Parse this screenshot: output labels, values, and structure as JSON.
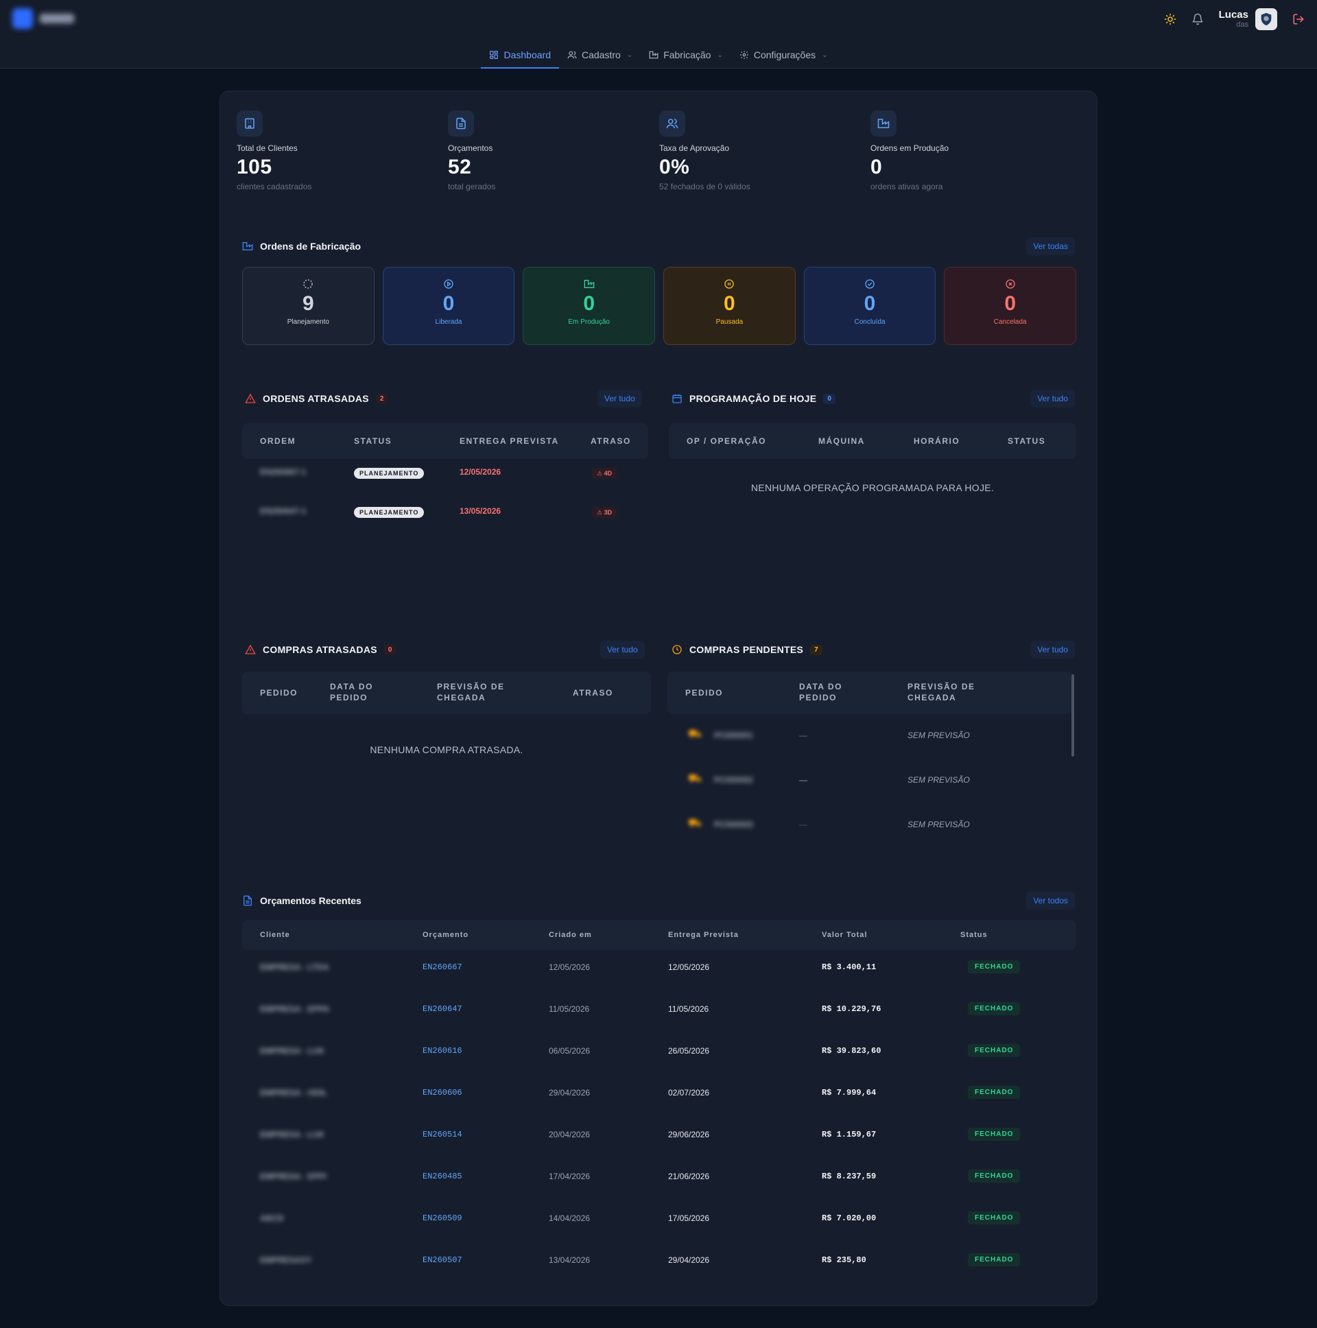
{
  "user": {
    "name": "Lucas",
    "role": "das"
  },
  "nav": [
    {
      "label": "Dashboard",
      "icon": "dashboard-icon",
      "active": true
    },
    {
      "label": "Cadastro",
      "icon": "users-icon",
      "dropdown": true
    },
    {
      "label": "Fabricação",
      "icon": "factory-icon",
      "dropdown": true
    },
    {
      "label": "Configurações",
      "icon": "gear-icon",
      "dropdown": true
    }
  ],
  "kpis": [
    {
      "label": "Total de Clientes",
      "value": "105",
      "sub": "clientes cadastrados",
      "icon": "building-icon"
    },
    {
      "label": "Orçamentos",
      "value": "52",
      "sub": "total gerados",
      "icon": "document-icon"
    },
    {
      "label": "Taxa de Aprovação",
      "value": "0%",
      "sub": "52 fechados de 0 válidos",
      "icon": "users-icon"
    },
    {
      "label": "Ordens em Produção",
      "value": "0",
      "sub": "ordens ativas agora",
      "icon": "factory-icon"
    }
  ],
  "fabrication": {
    "title": "Ordens de Fabricação",
    "link": "Ver todas",
    "cards": [
      {
        "value": "9",
        "label": "Planejamento",
        "color": "#d1d5db",
        "bg": "#1b2231",
        "border": "#374151"
      },
      {
        "value": "0",
        "label": "Liberada",
        "color": "#60a5fa",
        "bg": "#172447",
        "border": "#27427a"
      },
      {
        "value": "0",
        "label": "Em Produção",
        "color": "#34d399",
        "bg": "#13302b",
        "border": "#1f4a40"
      },
      {
        "value": "0",
        "label": "Pausada",
        "color": "#fbbf24",
        "bg": "#2e2317",
        "border": "#5a3e1d"
      },
      {
        "value": "0",
        "label": "Concluída",
        "color": "#60a5fa",
        "bg": "#172447",
        "border": "#27427a"
      },
      {
        "value": "0",
        "label": "Cancelada",
        "color": "#f87171",
        "bg": "#2e1a22",
        "border": "#5c2630"
      }
    ]
  },
  "late_orders": {
    "title": "ORDENS ATRASADAS",
    "count": "2",
    "link": "Ver tudo",
    "headers": [
      "ORDEM",
      "STATUS",
      "ENTREGA PREVISTA",
      "ATRASO"
    ],
    "rows": [
      {
        "order": "EN260667-1",
        "status": "PLANEJAMENTO",
        "due": "12/05/2026",
        "late": "4D"
      },
      {
        "order": "EN260647-1",
        "status": "PLANEJAMENTO",
        "due": "13/05/2026",
        "late": "3D"
      }
    ]
  },
  "today": {
    "title": "PROGRAMAÇÃO DE HOJE",
    "count": "0",
    "link": "Ver tudo",
    "headers": [
      "OP / OPERAÇÃO",
      "MÁQUINA",
      "HORÁRIO",
      "STATUS"
    ],
    "empty": "NENHUMA OPERAÇÃO PROGRAMADA PARA HOJE."
  },
  "late_purchases": {
    "title": "COMPRAS ATRASADAS",
    "count": "0",
    "link": "Ver tudo",
    "headers": [
      "PEDIDO",
      "DATA DO PEDIDO",
      "PREVISÃO DE CHEGADA",
      "ATRASO"
    ],
    "empty": "NENHUMA COMPRA ATRASADA."
  },
  "pending_purchases": {
    "title": "COMPRAS PENDENTES",
    "count": "7",
    "link": "Ver tudo",
    "headers": [
      "PEDIDO",
      "DATA DO PEDIDO",
      "PREVISÃO DE CHEGADA"
    ],
    "rows": [
      {
        "order": "PC000001",
        "date": "—",
        "forecast": "SEM PREVISÃO"
      },
      {
        "order": "PC000002",
        "date": "—",
        "forecast": "SEM PREVISÃO"
      },
      {
        "order": "PC000003",
        "date": "—",
        "forecast": "SEM PREVISÃO"
      }
    ]
  },
  "quotes": {
    "title": "Orçamentos Recentes",
    "link": "Ver todos",
    "headers": [
      "Cliente",
      "Orçamento",
      "Criado em",
      "Entrega Prevista",
      "Valor Total",
      "Status"
    ],
    "rows": [
      {
        "client": "EMPRESA - LTDA",
        "quote": "EN260667",
        "created": "12/05/2026",
        "due": "12/05/2026",
        "total": "R$ 3.400,11",
        "status": "FECHADO"
      },
      {
        "client": "EMPRESA - EPPA",
        "quote": "EN260647",
        "created": "11/05/2026",
        "due": "11/05/2026",
        "total": "R$ 10.229,76",
        "status": "FECHADO"
      },
      {
        "client": "EMPRESA - LUK",
        "quote": "EN260616",
        "created": "06/05/2026",
        "due": "26/05/2026",
        "total": "R$ 39.823,60",
        "status": "FECHADO"
      },
      {
        "client": "EMPRESA - ODIL",
        "quote": "EN260606",
        "created": "29/04/2026",
        "due": "02/07/2026",
        "total": "R$ 7.999,64",
        "status": "FECHADO"
      },
      {
        "client": "EMPRESA - LUK",
        "quote": "EN260514",
        "created": "20/04/2026",
        "due": "29/06/2026",
        "total": "R$ 1.159,67",
        "status": "FECHADO"
      },
      {
        "client": "EMPRESA - EPPI",
        "quote": "EN260485",
        "created": "17/04/2026",
        "due": "21/06/2026",
        "total": "R$ 8.237,59",
        "status": "FECHADO"
      },
      {
        "client": "ABCD",
        "quote": "EN260509",
        "created": "14/04/2026",
        "due": "17/05/2026",
        "total": "R$ 7.020,00",
        "status": "FECHADO"
      },
      {
        "client": "EMPRESAXY",
        "quote": "EN260507",
        "created": "13/04/2026",
        "due": "29/04/2026",
        "total": "R$ 235,80",
        "status": "FECHADO"
      }
    ]
  }
}
